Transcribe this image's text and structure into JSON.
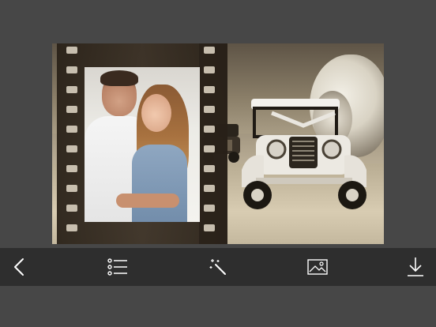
{
  "colors": {
    "background": "#474747",
    "toolbar": "#2e2e2e",
    "icon": "#ffffff"
  },
  "toolbar": {
    "items": [
      {
        "icon": "back-chevron-icon"
      },
      {
        "icon": "list-icon"
      },
      {
        "icon": "magic-wand-icon"
      },
      {
        "icon": "image-icon"
      },
      {
        "icon": "download-icon"
      }
    ]
  },
  "canvas": {
    "frame_style": "film-strip",
    "background": "vintage-car-sepia",
    "photo": "couple-portrait"
  }
}
